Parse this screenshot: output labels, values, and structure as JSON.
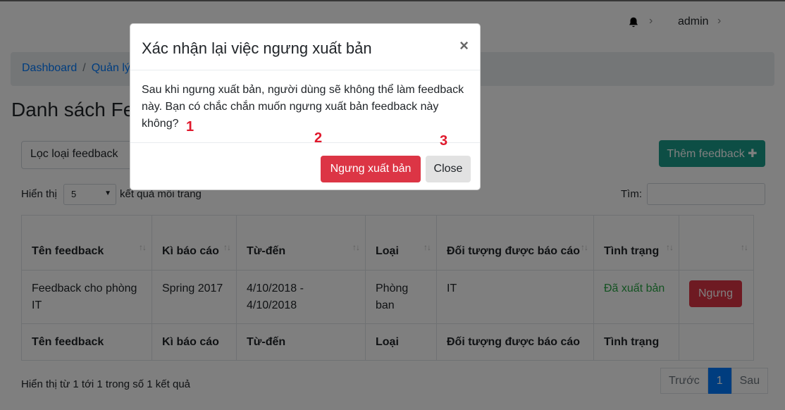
{
  "topbar": {
    "bell_icon": "bell-icon",
    "user": "admin"
  },
  "breadcrumb": {
    "item1": "Dashboard",
    "item2": "Quản lý"
  },
  "page": {
    "title": "Danh sách Fe"
  },
  "toolbar": {
    "filter_label": "Lọc loại feedback",
    "add_label": "Thêm feedback",
    "add_icon": "plus-icon"
  },
  "length": {
    "prefix": "Hiển thị",
    "value": "5",
    "suffix": "kết quả mỗi trang"
  },
  "search": {
    "label": "Tìm:"
  },
  "table": {
    "headers": [
      "Tên feedback",
      "Kì báo cáo",
      "Từ-đến",
      "Loại",
      "Đối tượng được báo cáo",
      "Tình trạng",
      ""
    ],
    "row": {
      "name": "Feedback cho phòng IT",
      "period": "Spring 2017",
      "range": "4/10/2018 - 4/10/2018",
      "type": "Phòng ban",
      "target": "IT",
      "status": "Đã xuất bản",
      "action": "Ngưng"
    },
    "footer": [
      "Tên feedback",
      "Kì báo cáo",
      "Từ-đến",
      "Loại",
      "Đối tượng được báo cáo",
      "Tình trạng",
      ""
    ]
  },
  "info": "Hiển thị từ 1 tới 1 trong số 1 kết quả",
  "pager": {
    "prev": "Trước",
    "current": "1",
    "next": "Sau"
  },
  "modal": {
    "title": "Xác nhận lại việc ngưng xuất bản",
    "close_symbol": "×",
    "body": "Sau khi ngưng xuất bản, người dùng sẽ không thể làm feedback này. Bạn có chắc chắn muốn ngưng xuất bản feedback này không?",
    "confirm": "Ngưng xuất bản",
    "cancel": "Close"
  },
  "markers": [
    "1",
    "2",
    "3"
  ],
  "colors": {
    "danger": "#dc3545",
    "teal": "#1a9d8a",
    "primary": "#007bff",
    "marker": "#e0192c"
  }
}
